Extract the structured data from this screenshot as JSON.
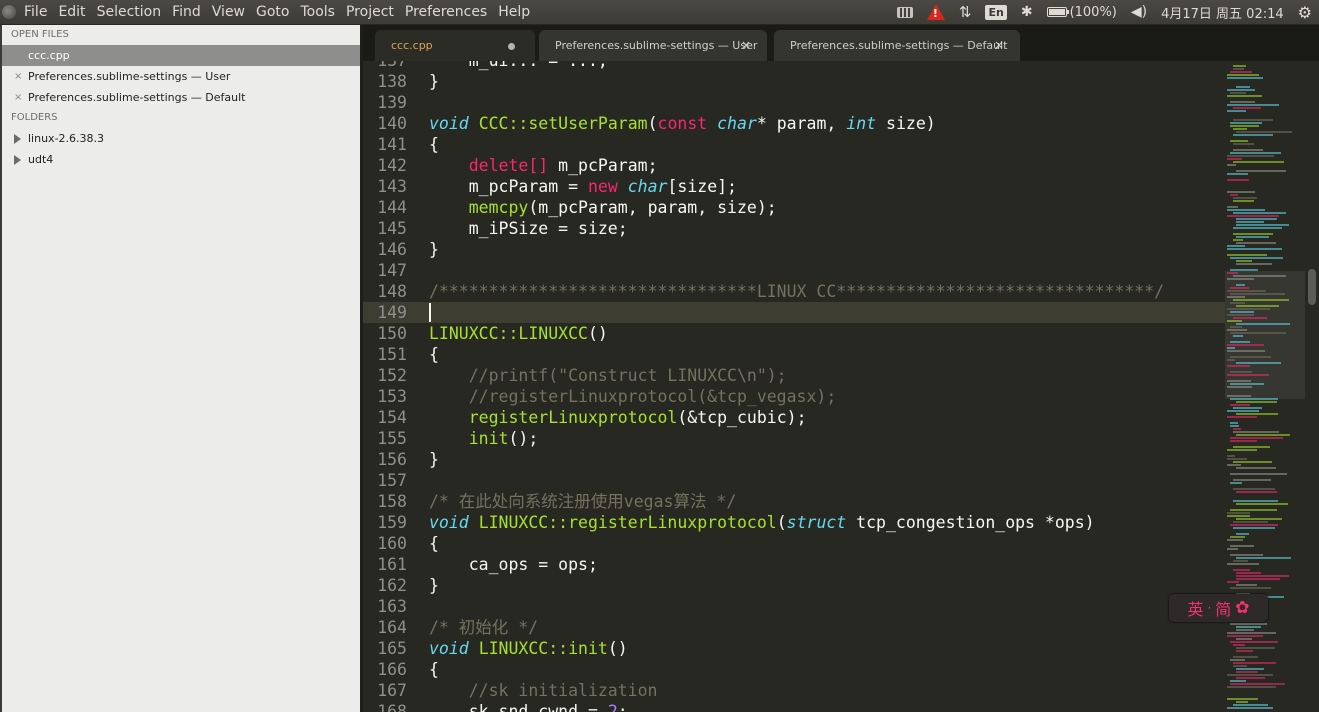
{
  "menubar": {
    "items": [
      "File",
      "Edit",
      "Selection",
      "Find",
      "View",
      "Goto",
      "Tools",
      "Project",
      "Preferences",
      "Help"
    ]
  },
  "tray": {
    "input_method": "En",
    "battery": "(100%)",
    "battery_level": 1.0,
    "datetime": "4月17日 周五 02:14",
    "icons": [
      "keyboard-icon",
      "warning-icon",
      "network-updown-icon",
      "bluetooth-icon",
      "battery-icon",
      "volume-icon",
      "settings-gear-icon"
    ]
  },
  "sidebar": {
    "open_files_header": "OPEN FILES",
    "open_files": [
      {
        "label": "ccc.cpp",
        "active": true
      },
      {
        "label": "Preferences.sublime-settings — User",
        "active": false
      },
      {
        "label": "Preferences.sublime-settings — Default",
        "active": false
      }
    ],
    "folders_header": "FOLDERS",
    "folders": [
      "linux-2.6.38.3",
      "udt4"
    ],
    "close_glyph": "×"
  },
  "tabs": [
    {
      "label": "ccc.cpp",
      "modified": true
    },
    {
      "label": "Preferences.sublime-settings — User",
      "close": "×"
    },
    {
      "label": "Preferences.sublime-settings — Default",
      "close": "×"
    }
  ],
  "editor": {
    "current_line": 149,
    "lines": [
      {
        "n": "137",
        "seg": [
          [
            "    m_ui... = ...;",
            ""
          ]
        ]
      },
      {
        "n": "138",
        "seg": [
          [
            "}",
            ""
          ]
        ]
      },
      {
        "n": "139",
        "seg": []
      },
      {
        "n": "140",
        "seg": [
          [
            "void",
            "kw"
          ],
          [
            " ",
            ""
          ],
          [
            "CCC::setUserParam",
            "fn"
          ],
          [
            "(",
            ""
          ],
          [
            "const",
            "pk"
          ],
          [
            " ",
            ""
          ],
          [
            "char",
            "kw"
          ],
          [
            "* param, ",
            ""
          ],
          [
            "int",
            "kw"
          ],
          [
            " size)",
            ""
          ]
        ]
      },
      {
        "n": "141",
        "seg": [
          [
            "{",
            ""
          ]
        ]
      },
      {
        "n": "142",
        "seg": [
          [
            "    ",
            ""
          ],
          [
            "delete[]",
            "pk"
          ],
          [
            " m_pcParam;",
            ""
          ]
        ]
      },
      {
        "n": "143",
        "seg": [
          [
            "    m_pcParam = ",
            ""
          ],
          [
            "new",
            "pk"
          ],
          [
            " ",
            ""
          ],
          [
            "char",
            "kw"
          ],
          [
            "[size];",
            ""
          ]
        ]
      },
      {
        "n": "144",
        "seg": [
          [
            "    ",
            ""
          ],
          [
            "memcpy",
            "fn"
          ],
          [
            "(m_pcParam, param, size);",
            ""
          ]
        ]
      },
      {
        "n": "145",
        "seg": [
          [
            "    m_iPSize = size;",
            ""
          ]
        ]
      },
      {
        "n": "146",
        "seg": [
          [
            "}",
            ""
          ]
        ]
      },
      {
        "n": "147",
        "seg": []
      },
      {
        "n": "148",
        "seg": [
          [
            "/********************************LINUX CC********************************/",
            "cm"
          ]
        ]
      },
      {
        "n": "149",
        "seg": []
      },
      {
        "n": "150",
        "seg": [
          [
            "LINUXCC::LINUXCC",
            "fn"
          ],
          [
            "()",
            ""
          ]
        ]
      },
      {
        "n": "151",
        "seg": [
          [
            "{",
            ""
          ]
        ]
      },
      {
        "n": "152",
        "seg": [
          [
            "    //printf(\"Construct LINUXCC\\n\");",
            "cm"
          ]
        ]
      },
      {
        "n": "153",
        "seg": [
          [
            "    //registerLinuxprotocol(&tcp_vegasx);",
            "cm"
          ]
        ]
      },
      {
        "n": "154",
        "seg": [
          [
            "    ",
            ""
          ],
          [
            "registerLinuxprotocol",
            "fn"
          ],
          [
            "(&tcp_cubic);",
            ""
          ]
        ]
      },
      {
        "n": "155",
        "seg": [
          [
            "    ",
            ""
          ],
          [
            "init",
            "fn"
          ],
          [
            "();",
            ""
          ]
        ]
      },
      {
        "n": "156",
        "seg": [
          [
            "}",
            ""
          ]
        ]
      },
      {
        "n": "157",
        "seg": []
      },
      {
        "n": "158",
        "seg": [
          [
            "/* 在此处向系统注册使用vegas算法 */",
            "cm"
          ]
        ]
      },
      {
        "n": "159",
        "seg": [
          [
            "void",
            "kw"
          ],
          [
            " ",
            ""
          ],
          [
            "LINUXCC::registerLinuxprotocol",
            "fn"
          ],
          [
            "(",
            ""
          ],
          [
            "struct",
            "kw"
          ],
          [
            " tcp_congestion_ops *ops)",
            ""
          ]
        ]
      },
      {
        "n": "160",
        "seg": [
          [
            "{",
            ""
          ]
        ]
      },
      {
        "n": "161",
        "seg": [
          [
            "    ca_ops = ops;",
            ""
          ]
        ]
      },
      {
        "n": "162",
        "seg": [
          [
            "}",
            ""
          ]
        ]
      },
      {
        "n": "163",
        "seg": []
      },
      {
        "n": "164",
        "seg": [
          [
            "/* 初始化 */",
            "cm"
          ]
        ]
      },
      {
        "n": "165",
        "seg": [
          [
            "void",
            "kw"
          ],
          [
            " ",
            ""
          ],
          [
            "LINUXCC::init",
            "fn"
          ],
          [
            "()",
            ""
          ]
        ]
      },
      {
        "n": "166",
        "seg": [
          [
            "{",
            ""
          ]
        ]
      },
      {
        "n": "167",
        "seg": [
          [
            "    //sk initialization",
            "cm"
          ]
        ]
      },
      {
        "n": "168",
        "seg": [
          [
            "    sk_snd_cwnd = ",
            ""
          ],
          [
            "2",
            "num"
          ],
          [
            ";",
            ""
          ]
        ]
      }
    ]
  },
  "ime": {
    "lang": "英",
    "sep": "·",
    "mode": "简",
    "icon": "ime-gear-icon"
  },
  "colors": {
    "editor_bg": "#272822",
    "keyword": "#66d9ef",
    "function": "#a6e22e",
    "storage": "#f92672",
    "comment": "#75715e",
    "number": "#ae81ff",
    "tab_active_text": "#e0a352",
    "ime": "#f0326e"
  }
}
